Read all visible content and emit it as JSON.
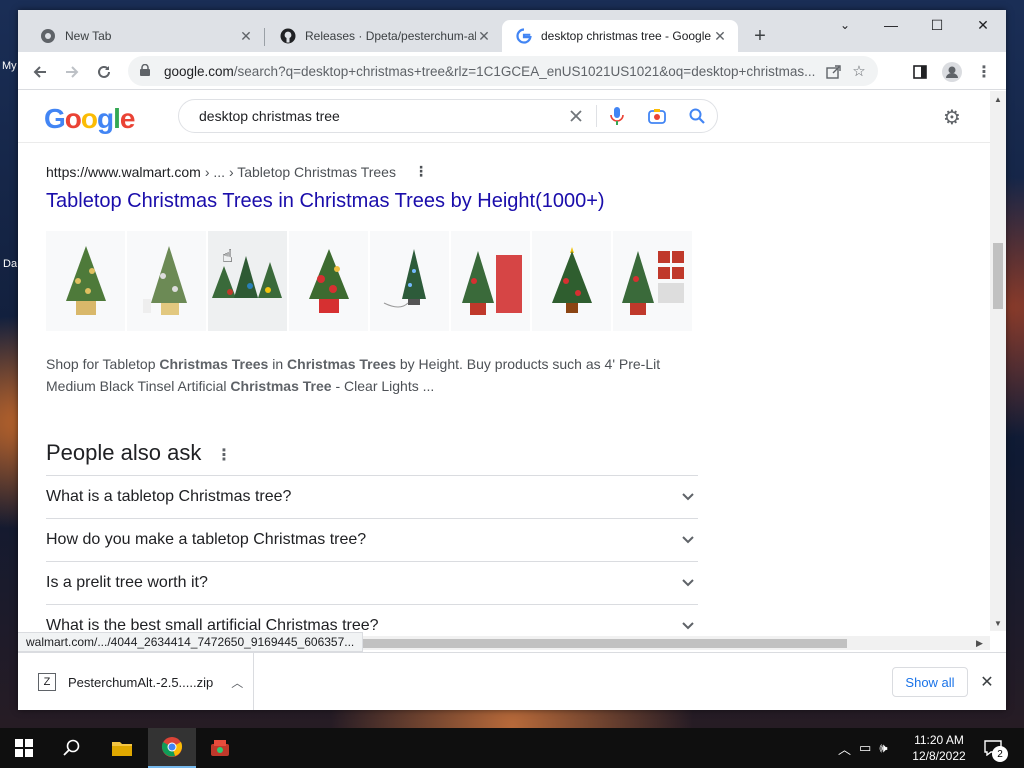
{
  "desktop": {
    "left_labels": [
      "My",
      "Da"
    ]
  },
  "browser": {
    "tabs": [
      {
        "title": "New Tab",
        "favicon": "chrome-icon"
      },
      {
        "title": "Releases · Dpeta/pesterchum-alt",
        "favicon": "github-icon"
      },
      {
        "title": "desktop christmas tree - Google",
        "favicon": "google-g-icon",
        "active": true
      }
    ],
    "window_controls": {
      "minimize": "—",
      "maximize": "☐",
      "close": "✕"
    },
    "address": {
      "host": "google.com",
      "path": "/search?q=desktop+christmas+tree&rlz=1C1GCEA_enUS1021US1021&oq=desktop+christmas..."
    }
  },
  "google": {
    "logo_text": "Google",
    "query": "desktop christmas tree",
    "result": {
      "site": "https://www.walmart.com",
      "breadcrumb": "› ... › Tabletop Christmas Trees",
      "title": "Tabletop Christmas Trees in Christmas Trees by Height(1000+)",
      "thumbnails": [
        "gold-tree-thumbnail",
        "snowy-tree-with-figures-thumbnail",
        "multi-tree-set-thumbnail",
        "red-ornament-tree-thumbnail",
        "led-fiber-tree-thumbnail",
        "tree-with-box-thumbnail",
        "tree-with-star-thumbnail",
        "tree-with-ornament-pack-thumbnail"
      ],
      "snippet_parts": [
        {
          "text": "Shop for Tabletop ",
          "bold": false
        },
        {
          "text": "Christmas Trees",
          "bold": true
        },
        {
          "text": " in ",
          "bold": false
        },
        {
          "text": "Christmas Trees",
          "bold": true
        },
        {
          "text": " by Height. Buy products such as 4' Pre-Lit Medium Black Tinsel Artificial ",
          "bold": false
        },
        {
          "text": "Christmas Tree",
          "bold": true
        },
        {
          "text": " - Clear Lights ...",
          "bold": false
        }
      ]
    },
    "people_also_ask": {
      "title": "People also ask",
      "questions": [
        "What is a tabletop Christmas tree?",
        "How do you make a tabletop Christmas tree?",
        "Is a prelit tree worth it?",
        "What is the best small artificial Christmas tree?"
      ]
    }
  },
  "status_url": "walmart.com/.../4044_2634414_7472650_9169445_606357...",
  "downloads": {
    "file_name": "PesterchumAlt.-2.5.....zip",
    "show_all_label": "Show all"
  },
  "taskbar": {
    "time": "11:20 AM",
    "date": "12/8/2022",
    "notification_count": "2"
  },
  "colors": {
    "link": "#1a0dab",
    "accent_blue": "#1a73e8",
    "tabstrip": "#dee1e6"
  }
}
